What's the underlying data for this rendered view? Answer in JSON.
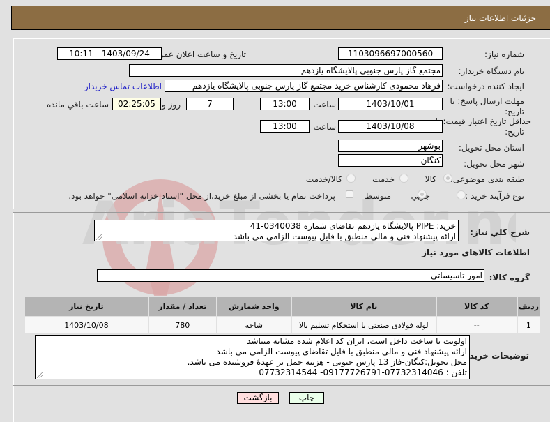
{
  "header": {
    "title": "جزئیات اطلاعات نیاز"
  },
  "labels": {
    "need_number": "شماره نیاز:",
    "announce_datetime": "تاریخ و ساعت اعلان عمومي:",
    "buyer_org": "نام دستگاه خريدار:",
    "requester": "ایجاد کننده درخواست:",
    "contact_link": "اطلاعات تماس خریدار",
    "response_deadline_line1": "مهلت ارسال پاسخ: تا",
    "response_deadline_line2": "تاریخ:",
    "time_word": "ساعت",
    "days_and": "روز و",
    "hours_remaining": "ساعت باقي مانده",
    "price_validity_line1": "حداقل تاريخ اعتبار قيمت: تا",
    "price_validity_line2": "تاریخ:",
    "delivery_province": "استان محل تحویل:",
    "delivery_city": "شهر محل تحویل:",
    "category": "طبقه بندی موضوعی:",
    "process_type": "نوع فرآیند خرید :",
    "general_description": "شرح کلي نياز:",
    "goods_info_heading": "اطلاعات کالاهاي مورد نياز",
    "goods_group": "گروه کالا:",
    "buyer_notes": "توضیحات خریدار:"
  },
  "values": {
    "need_number": "1103096697000560",
    "announce_datetime": "1403/09/24 - 10:11",
    "buyer_org": "مجتمع گاز پارس جنوبی  پالایشگاه یازدهم",
    "requester": "فرهاد محمودی کارشناس خرید مجتمع گاز پارس جنوبی  پالایشگاه یازدهم",
    "response_date": "1403/10/01",
    "response_time": "13:00",
    "days_remaining": "7",
    "time_remaining": "02:25:05",
    "price_validity_date": "1403/10/08",
    "price_validity_time": "13:00",
    "delivery_province": "بوشهر",
    "delivery_city": "کنگان",
    "goods_group": "امور تاسیساتی"
  },
  "category_options": [
    {
      "label": "کالا",
      "selected": true
    },
    {
      "label": "خدمت",
      "selected": false
    },
    {
      "label": "کالا/خدمت",
      "selected": false
    }
  ],
  "process_options": [
    {
      "label": "جزيي",
      "selected": false
    },
    {
      "label": "متوسط",
      "selected": true
    }
  ],
  "treasury_checkbox": {
    "label": "پرداخت تمام یا بخشی از مبلغ خرید،از محل \"اسناد خزانه اسلامی\" خواهد بود.",
    "checked": false
  },
  "general_description": {
    "line1": "خرید:  PIPE  پالایشگاه یازدهم تقاضای شماره 0340038-41",
    "line2": "ارائه پیشنهاد فنی و مالی منطبق با فایل پیوست الزامی می باشد"
  },
  "items_table": {
    "columns": [
      "ردیف",
      "کد کالا",
      "نام کالا",
      "واحد شمارش",
      "تعداد / مقدار",
      "تاریخ نیاز"
    ],
    "rows": [
      [
        "1",
        "--",
        "لوله فولادی صنعتی با استحکام تسلیم بالا",
        "شاخه",
        "780",
        "1403/10/08"
      ]
    ]
  },
  "buyer_notes": {
    "line1": "اولویت با ساخت داخل است، ایران کد اعلام شده مشابه میباشد",
    "line2": "ارائه پیشنهاد فنی و مالی منطبق با فایل تقاضای پیوست الزامی می باشد",
    "line3": "محل تحویل:کنگان-فاز 13 پارس جنوبی - هزینه حمل بر عهدهٔ فروشنده می باشد.",
    "line4": "تلفن : 07732314046-09177726791- 07732314544"
  },
  "buttons": {
    "print": "چاپ",
    "back": "بازگشت"
  },
  "colors": {
    "header_bg": "#8c6d43",
    "print_bg": "#eaffea",
    "back_bg": "#ffdede",
    "link": "#2323c8"
  },
  "watermark": {
    "text": "AriaTender.neT"
  }
}
